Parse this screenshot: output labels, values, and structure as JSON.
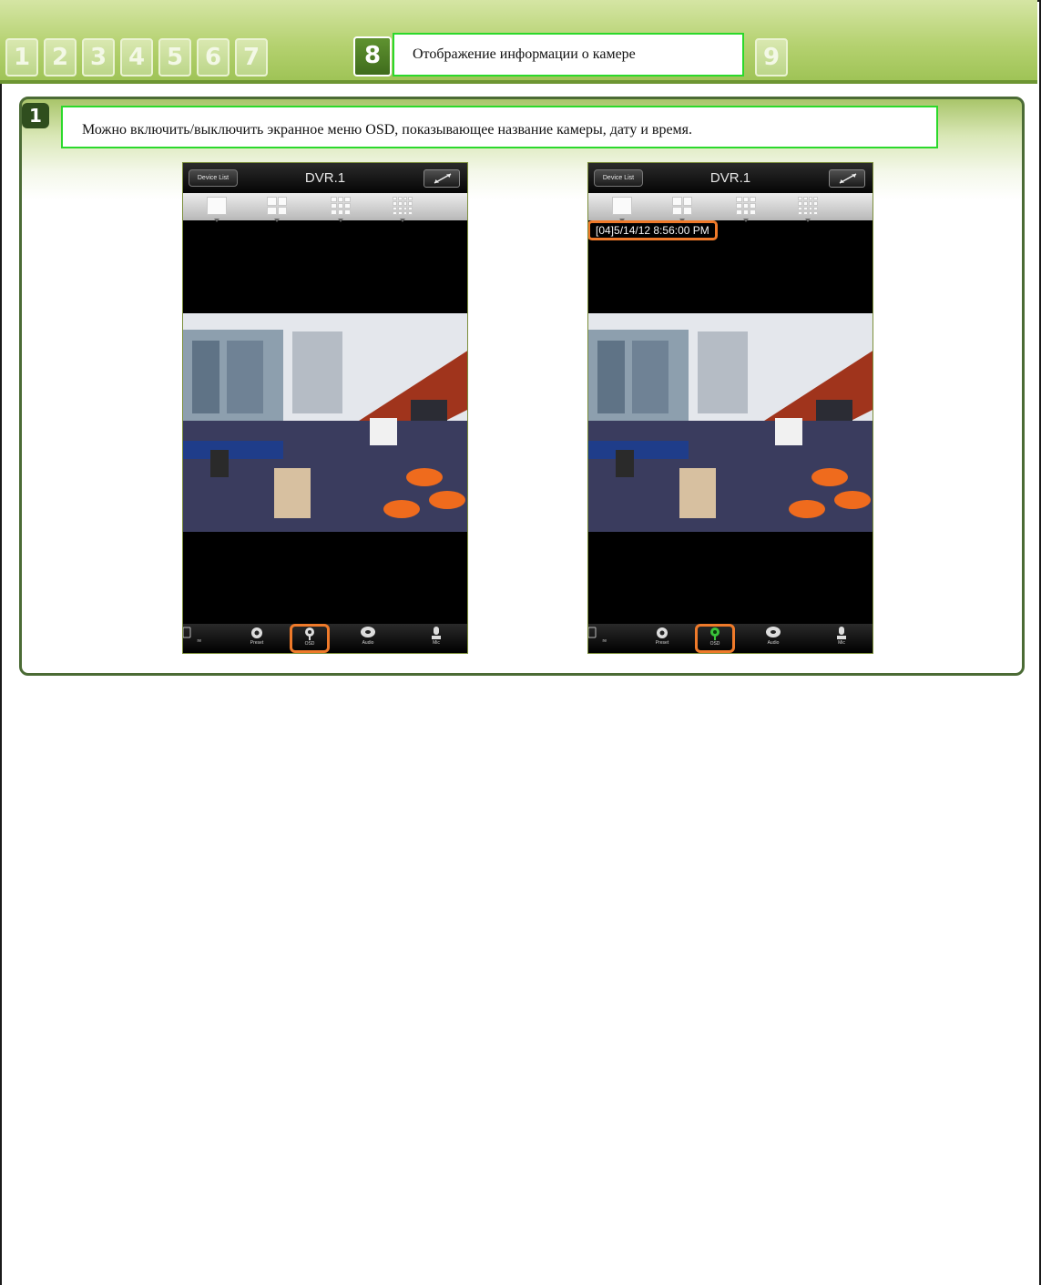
{
  "tabs": [
    {
      "label": "1",
      "active": false
    },
    {
      "label": "2",
      "active": false
    },
    {
      "label": "3",
      "active": false
    },
    {
      "label": "4",
      "active": false
    },
    {
      "label": "5",
      "active": false
    },
    {
      "label": "6",
      "active": false
    },
    {
      "label": "7",
      "active": false
    },
    {
      "label": "8",
      "active": true
    },
    {
      "label": "9",
      "active": false
    }
  ],
  "tab_title": "Отображение информации о камере",
  "step": {
    "number": "1",
    "description": "Можно включить/выключить экранное меню OSD, показывающее название камеры, дату и время."
  },
  "phone": {
    "device_list_label": "Device List",
    "title": "DVR.1",
    "toolbar": [
      "re",
      "Preset",
      "OSD",
      "Audio",
      "Mic"
    ]
  },
  "osd_overlay": "[04]5/14/12 8:56:00 PM",
  "colors": {
    "accent_green": "#2bd92b",
    "highlight_orange": "#ef7a2a",
    "panel_border": "#4b6b35"
  }
}
